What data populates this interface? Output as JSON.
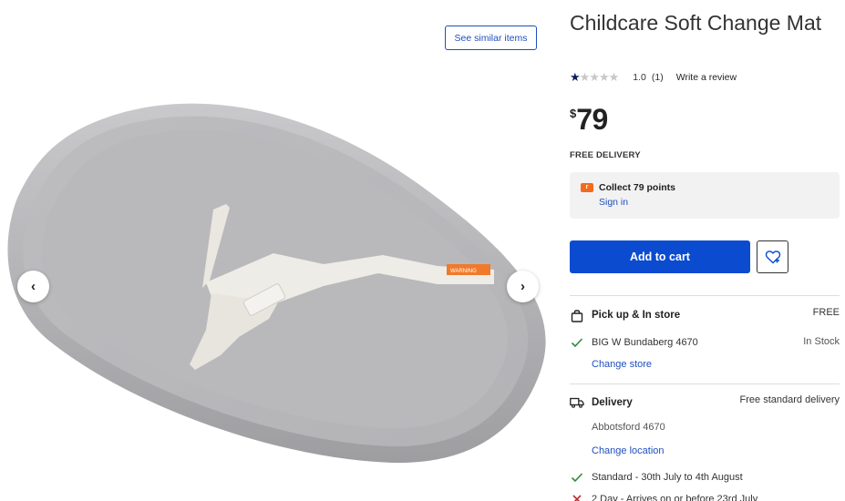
{
  "gallery": {
    "see_similar_label": "See similar items",
    "prev_arrow": "‹",
    "next_arrow": "›",
    "image_alt_icon": "change-mat-image",
    "strap_warning_label": "WARNING"
  },
  "product": {
    "title": "Childcare Soft Change Mat",
    "rating": {
      "value": "1.0",
      "count": "(1)",
      "stars_filled": 1,
      "stars_total": 5,
      "write_review": "Write a review"
    },
    "price": {
      "currency": "$",
      "amount": "79"
    },
    "free_delivery": "FREE DELIVERY"
  },
  "rewards": {
    "collect_text": "Collect 79 points",
    "sign_in": "Sign in"
  },
  "actions": {
    "add_to_cart": "Add to cart",
    "wishlist_icon": "heart-plus-icon"
  },
  "pickup": {
    "heading": "Pick up & In store",
    "price": "FREE",
    "store": "BIG W Bundaberg 4670",
    "stock": "In Stock",
    "change_store": "Change store"
  },
  "delivery": {
    "heading": "Delivery",
    "type": "Free standard delivery",
    "location": "Abbotsford 4670",
    "change_location": "Change location",
    "options": [
      {
        "label": "Standard - 30th July to 4th August",
        "available": true
      },
      {
        "label": "2 Day - Arrives on or before 23rd July",
        "available": false
      }
    ]
  },
  "colors": {
    "primary_blue": "#0a4bd0",
    "link_blue": "#1f4fbf",
    "star_navy": "#0b1f5c",
    "points_orange": "#f26b1d",
    "check_green": "#2e8b3a",
    "cross_red": "#c0282d"
  }
}
